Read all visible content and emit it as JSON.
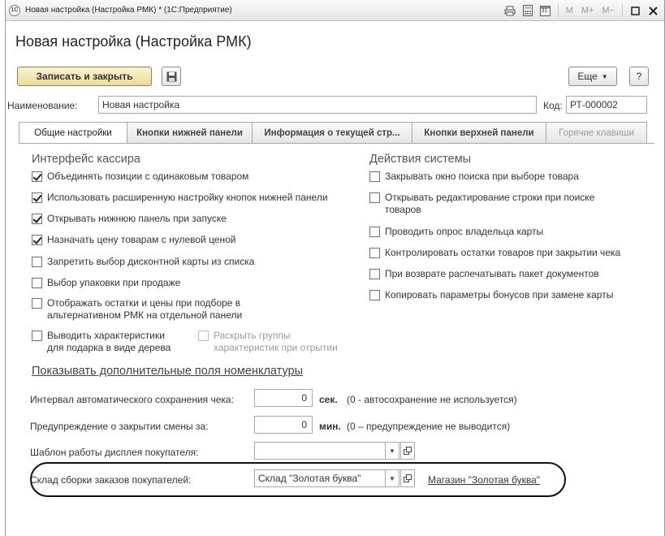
{
  "window": {
    "app_logo": "1С",
    "title": "Новая настройка (Настройка РМК) * (1С:Предприятие)",
    "tools": [
      "printer-icon",
      "calculator-icon",
      "calendar-icon"
    ],
    "memory_buttons": [
      "M",
      "M+",
      "M−"
    ],
    "calendar_day": "31"
  },
  "form": {
    "title": "Новая настройка (Настройка РМК)",
    "save_close_label": "Записать и закрыть",
    "more_label": "Еще",
    "help_label": "?",
    "name_label": "Наименование:",
    "name_value": "Новая настройка",
    "code_label": "Код:",
    "code_value": "РТ-000002"
  },
  "tabs": [
    {
      "label": "Общие настройки",
      "state": "active"
    },
    {
      "label": "Кнопки нижней панели",
      "state": "normal"
    },
    {
      "label": "Информация о текущей стр...",
      "state": "normal"
    },
    {
      "label": "Кнопки верхней панели",
      "state": "normal"
    },
    {
      "label": "Горячие клавиши",
      "state": "disabled"
    }
  ],
  "interface": {
    "title": "Интерфейс кассира",
    "items": [
      {
        "label": "Объединять позиции с одинаковым товаром",
        "checked": true
      },
      {
        "label": "Использовать расширенную настройку кнопок нижней панели",
        "checked": true
      },
      {
        "label": "Открывать нижнюю панель при запуске",
        "checked": true
      },
      {
        "label": "Назначать цену товарам с нулевой ценой",
        "checked": true
      },
      {
        "label": "Запретить выбор дисконтной карты из списка",
        "checked": false
      },
      {
        "label": "Выбор упаковки при продаже",
        "checked": false
      },
      {
        "label": "Отображать остатки и цены при подборе в альтернативном РМК на отдельной панели",
        "line1": "Отображать остатки и цены при подборе в",
        "line2": "альтернативном РМК на отдельной панели",
        "checked": false
      },
      {
        "label": "Выводить характеристики для подарка в виде дерева",
        "line1": "Выводить характеристики",
        "line2": "для подарка в виде дерева",
        "checked": false
      }
    ],
    "sub_option": {
      "line1": "Раскрыть группы",
      "line2": "характеристик при отрытии",
      "checked": false,
      "disabled": true
    }
  },
  "system": {
    "title": "Действия системы",
    "items": [
      {
        "label": "Закрывать окно поиска при выборе товара",
        "checked": false
      },
      {
        "label": "Открывать редактирование строки при поиске товаров",
        "line1": "Открывать редактирование строки при поиске",
        "line2": "товаров",
        "checked": false
      },
      {
        "label": "Проводить опрос владельца карты",
        "checked": false
      },
      {
        "label": "Контролировать остатки товаров при закрытии чека",
        "checked": false
      },
      {
        "label": "При возврате распечатывать пакет документов",
        "checked": false
      },
      {
        "label": "Копировать параметры бонусов при замене карты",
        "checked": false
      }
    ]
  },
  "extra_fields_link": "Показывать дополнительные поля номенклатуры",
  "autosave": {
    "label": "Интервал автоматического сохранения чека:",
    "value": "0",
    "unit": "сек.",
    "hint": "(0 - автосохранение не используется)"
  },
  "shift_warning": {
    "label": "Предупреждение о закрытии смены за:",
    "value": "0",
    "unit": "мин.",
    "hint": "(0 – предупреждение не выводится)"
  },
  "display_template": {
    "label": "Шаблон работы дисплея покупателя:",
    "value": ""
  },
  "warehouse": {
    "label": "Склад сборки заказов покупателей:",
    "value": "Склад \"Золотая буква\"",
    "link": "Магазин \"Золотая буква\""
  }
}
